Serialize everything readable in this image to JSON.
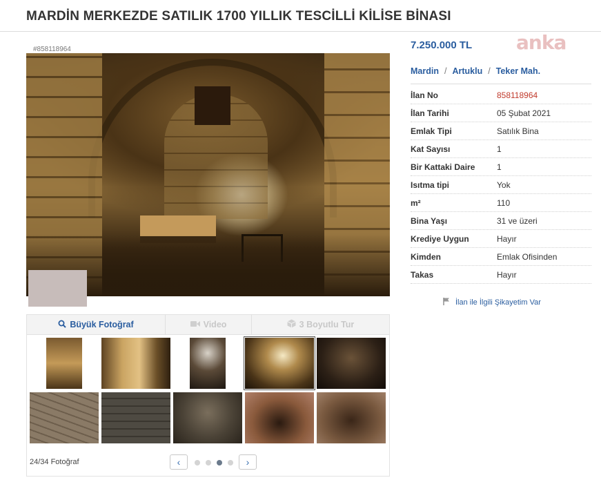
{
  "title": "MARDİN MERKEZDE SATILIK 1700 YILLIK TESCİLLİ KİLİSE BİNASI",
  "listing_ref": "#858118964",
  "watermark": "anka",
  "price": "7.250.000 TL",
  "breadcrumb": [
    "Mardin",
    "Artuklu",
    "Teker Mah."
  ],
  "breadcrumb_sep": "/",
  "specs": [
    {
      "label": "İlan No",
      "value": "858118964"
    },
    {
      "label": "İlan Tarihi",
      "value": "05 Şubat 2021"
    },
    {
      "label": "Emlak Tipi",
      "value": "Satılık Bina"
    },
    {
      "label": "Kat Sayısı",
      "value": "1"
    },
    {
      "label": "Bir Kattaki Daire",
      "value": "1"
    },
    {
      "label": "Isıtma tipi",
      "value": "Yok"
    },
    {
      "label": "m²",
      "value": "110"
    },
    {
      "label": "Bina Yaşı",
      "value": "31 ve üzeri"
    },
    {
      "label": "Krediye Uygun",
      "value": "Hayır"
    },
    {
      "label": "Kimden",
      "value": "Emlak Ofisinden"
    },
    {
      "label": "Takas",
      "value": "Hayır"
    }
  ],
  "complaint_link": "İlan ile İlgili Şikayetim Var",
  "tabs": {
    "big_photo": "Büyük Fotoğraf",
    "video": "Video",
    "tour_3d": "3 Boyutlu Tur"
  },
  "pager": {
    "text": "24/34 Fotoğraf",
    "prev": "‹",
    "next": "›",
    "active_dot": 3,
    "dot_count": 4
  },
  "colors": {
    "link_blue": "#2a5d9f",
    "id_red": "#c0392b",
    "watermark": "#d78c8c"
  },
  "icons": {
    "search": "magnifier",
    "video": "camera",
    "tour": "cube",
    "flag": "flag"
  }
}
